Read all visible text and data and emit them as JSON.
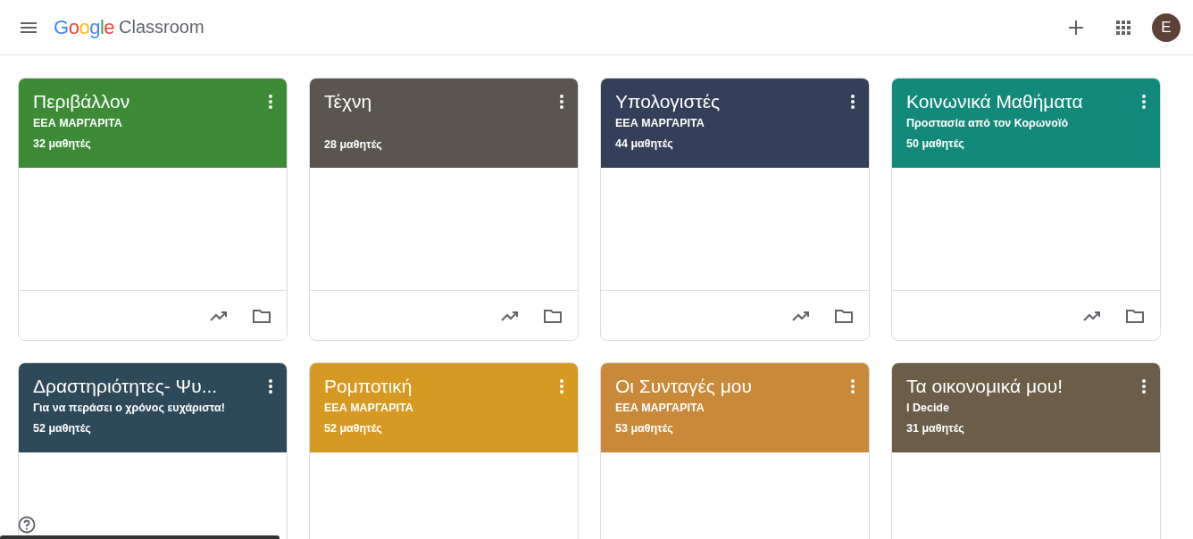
{
  "header": {
    "logo_brand": "Google",
    "logo_product": "Classroom",
    "avatar_letter": "E"
  },
  "classes": [
    {
      "title": "Περιβάλλον",
      "section": "ΕΕΑ ΜΑΡΓΑΡΙΤΑ",
      "students": "32 μαθητές",
      "color": "#3d8b37"
    },
    {
      "title": "Τέχνη",
      "students": "28 μαθητές",
      "color": "#5b5550"
    },
    {
      "title": "Υπολογιστές",
      "section": "ΕΕΑ ΜΑΡΓΑΡΙΤΑ",
      "students": "44 μαθητές",
      "color": "#34405a"
    },
    {
      "title": "Κοινωνικά Μαθήματα",
      "section": "Προστασία από τον Κορωνοϊό",
      "students": "50 μαθητές",
      "color": "#12897a"
    },
    {
      "title": "Δραστηριότητες- Ψυ...",
      "section": "Για να περάσει ο χρόνος ευχάριστα!",
      "students": "52 μαθητές",
      "color": "#2e4a5a"
    },
    {
      "title": "Ρομποτική",
      "section": "ΕΕΑ ΜΑΡΓΑΡΙΤΑ",
      "students": "52 μαθητές",
      "color": "#d69a22"
    },
    {
      "title": "Οι Συνταγές μου",
      "section": "ΕΕΑ ΜΑΡΓΑΡΙΤΑ",
      "students": "53 μαθητές",
      "color": "#c88a3a"
    },
    {
      "title": "Τα οικονομικά μου!",
      "section": "I Decide",
      "students": "31 μαθητές",
      "color": "#6b5d48"
    }
  ]
}
